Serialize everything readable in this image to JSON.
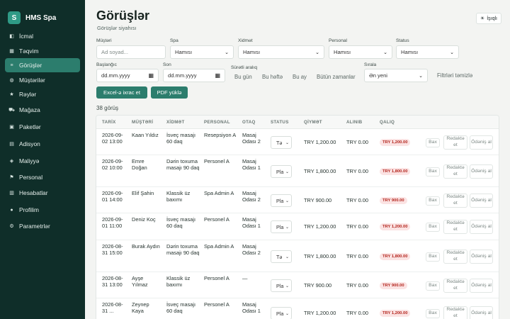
{
  "app": {
    "logo_letter": "S",
    "name": "HMS Spa"
  },
  "sidebar": {
    "items": [
      {
        "label": "İcmal",
        "icon": "dashboard-icon",
        "glyph": "◧"
      },
      {
        "label": "Təqvim",
        "icon": "calendar-icon",
        "glyph": "▦"
      },
      {
        "label": "Görüşlər",
        "icon": "list-icon",
        "glyph": "≡",
        "active": true
      },
      {
        "label": "Müştərilər",
        "icon": "users-icon",
        "glyph": "◍"
      },
      {
        "label": "Rəylər",
        "icon": "star-icon",
        "glyph": "★"
      },
      {
        "label": "Mağaza",
        "icon": "cart-icon",
        "glyph": "⛟"
      },
      {
        "label": "Paketlər",
        "icon": "package-icon",
        "glyph": "▣"
      },
      {
        "label": "Adisyon",
        "icon": "receipt-icon",
        "glyph": "▤"
      },
      {
        "label": "Maliyyə",
        "icon": "finance-icon",
        "glyph": "◈"
      },
      {
        "label": "Personal",
        "icon": "flag-icon",
        "glyph": "⚑"
      },
      {
        "label": "Hesabatlar",
        "icon": "chart-icon",
        "glyph": "▥"
      },
      {
        "label": "Profilim",
        "icon": "profile-icon",
        "glyph": "●"
      },
      {
        "label": "Parametrlər",
        "icon": "gear-icon",
        "glyph": "⚙"
      }
    ]
  },
  "header": {
    "title": "Görüşlər",
    "subtitle": "Görüşlər siyahısı",
    "light_label": "İşıqlı",
    "light_glyph": "☀"
  },
  "filters": {
    "customer": {
      "label": "Müştəri",
      "placeholder": "Ad soyad..."
    },
    "spa": {
      "label": "Spa",
      "value": "Hamısı"
    },
    "service": {
      "label": "Xidmət",
      "value": "Hamısı"
    },
    "staff": {
      "label": "Personal",
      "value": "Hamısı"
    },
    "status": {
      "label": "Status",
      "value": "Hamısı"
    },
    "start": {
      "label": "Başlanğıc",
      "value": "dd.mm.yyyy"
    },
    "end": {
      "label": "Son",
      "value": "dd.mm.yyyy"
    },
    "quick_label": "Sürətli aralıq",
    "quick": [
      "Bu gün",
      "Bu həftə",
      "Bu ay",
      "Bütün zamanlar"
    ],
    "sort": {
      "label": "Sırala",
      "value": "Ən yeni"
    },
    "clear_label": "Filtrləri təmizlə"
  },
  "actions": {
    "excel_label": "Excel-ə ixrac et",
    "pdf_label": "PDF yüklə"
  },
  "count_label": "38 görüş",
  "table": {
    "headers": [
      "TARİX",
      "MÜŞTƏRİ",
      "XİDMƏT",
      "PERSONAL",
      "OTAQ",
      "STATUS",
      "QİYMƏT",
      "ALINIB",
      "QALIQ"
    ],
    "row_actions": {
      "delete": "Bax",
      "edit": "Redaktə et",
      "pay": "Ödəniş al"
    },
    "rows": [
      {
        "date": "2026-09-02 13:00",
        "customer": "Kaan Yıldız",
        "service": "İsveç masajı 60 daq",
        "staff": "Resepsiyon A",
        "room": "Masaj Odası 2",
        "status": "Tə",
        "price": "TRY 1,200.00",
        "paid": "TRY 0.00",
        "balance": "TRY 1,200.00"
      },
      {
        "date": "2026-09-02 10:00",
        "customer": "Emre Doğan",
        "service": "Dərin toxuma masajı 90 daq",
        "staff": "Personel A",
        "room": "Masaj Odası 1",
        "status": "Pla",
        "price": "TRY 1,800.00",
        "paid": "TRY 0.00",
        "balance": "TRY 1,800.00"
      },
      {
        "date": "2026-09-01 14:00",
        "customer": "Elif Şahin",
        "service": "Klassik üz baxımı",
        "staff": "Spa Admin A",
        "room": "Masaj Odası 2",
        "status": "Pla",
        "price": "TRY 900.00",
        "paid": "TRY 0.00",
        "balance": "TRY 900.00"
      },
      {
        "date": "2026-09-01 11:00",
        "customer": "Deniz Koç",
        "service": "İsveç masajı 60 daq",
        "staff": "Personel A",
        "room": "Masaj Odası 1",
        "status": "Pla",
        "price": "TRY 1,200.00",
        "paid": "TRY 0.00",
        "balance": "TRY 1,200.00"
      },
      {
        "date": "2026-08-31 15:00",
        "customer": "Burak Aydın",
        "service": "Dərin toxuma masajı 90 daq",
        "staff": "Spa Admin A",
        "room": "Masaj Odası 2",
        "status": "Tə",
        "price": "TRY 1,800.00",
        "paid": "TRY 0.00",
        "balance": "TRY 1,800.00"
      },
      {
        "date": "2026-08-31 13:00",
        "customer": "Ayşe Yılmaz",
        "service": "Klassik üz baxımı",
        "staff": "Personel A",
        "room": "—",
        "status": "Pla",
        "price": "TRY 900.00",
        "paid": "TRY 0.00",
        "balance": "TRY 900.00"
      },
      {
        "date": "2026-08-31 ...",
        "customer": "Zeynep Kaya",
        "service": "İsveç masajı 60 daq",
        "staff": "Personel A",
        "room": "Masaj Odası 1",
        "status": "Pla",
        "price": "TRY 1,200.00",
        "paid": "TRY 0.00",
        "balance": "TRY 1,200.00"
      }
    ]
  }
}
